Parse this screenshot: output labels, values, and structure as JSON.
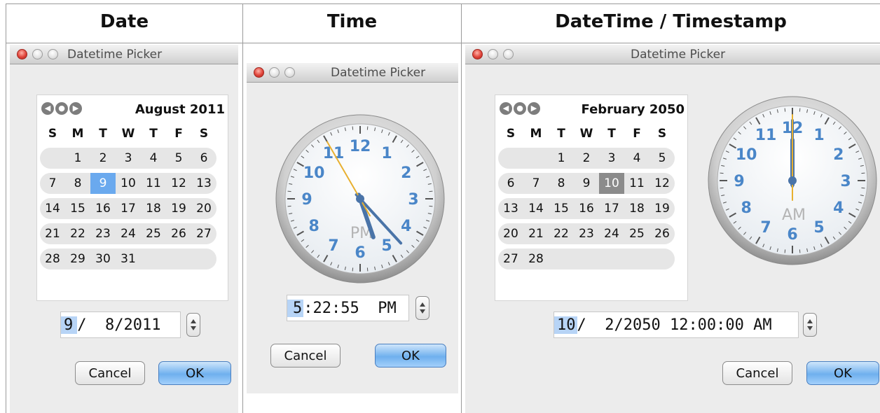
{
  "headers": {
    "date": "Date",
    "time": "Time",
    "datetime": "DateTime / Timestamp"
  },
  "windows": {
    "date": {
      "title": "Datetime Picker",
      "calendar": {
        "month_label": "August 2011",
        "nav": [
          "prev",
          "today",
          "next"
        ],
        "day_headers": [
          "S",
          "M",
          "T",
          "W",
          "T",
          "F",
          "S"
        ],
        "weeks": [
          [
            "",
            "1",
            "2",
            "3",
            "4",
            "5",
            "6"
          ],
          [
            "7",
            "8",
            "9",
            "10",
            "11",
            "12",
            "13"
          ],
          [
            "14",
            "15",
            "16",
            "17",
            "18",
            "19",
            "20"
          ],
          [
            "21",
            "22",
            "23",
            "24",
            "25",
            "26",
            "27"
          ],
          [
            "28",
            "29",
            "30",
            "31",
            "",
            "",
            ""
          ]
        ],
        "selected_day": "9"
      },
      "field": {
        "hl": "9",
        "rest": "/  8/2011"
      },
      "cancel_label": "Cancel",
      "ok_label": "OK"
    },
    "time": {
      "title": "Datetime Picker",
      "clock": {
        "hour": 5,
        "minute": 22,
        "second": 55,
        "period": "PM",
        "numerals": [
          "12",
          "1",
          "2",
          "3",
          "4",
          "5",
          "6",
          "7",
          "8",
          "9",
          "10",
          "11"
        ]
      },
      "field": {
        "hl": "5",
        "rest": ":22:55  PM"
      },
      "cancel_label": "Cancel",
      "ok_label": "OK"
    },
    "datetime": {
      "title": "Datetime Picker",
      "calendar": {
        "month_label": "February 2050",
        "nav": [
          "prev",
          "today",
          "next"
        ],
        "day_headers": [
          "S",
          "M",
          "T",
          "W",
          "T",
          "F",
          "S"
        ],
        "weeks": [
          [
            "",
            "",
            "1",
            "2",
            "3",
            "4",
            "5"
          ],
          [
            "6",
            "7",
            "8",
            "9",
            "10",
            "11",
            "12"
          ],
          [
            "13",
            "14",
            "15",
            "16",
            "17",
            "18",
            "19"
          ],
          [
            "20",
            "21",
            "22",
            "23",
            "24",
            "25",
            "26"
          ],
          [
            "27",
            "28",
            "",
            "",
            "",
            "",
            ""
          ]
        ],
        "selected_day": "10"
      },
      "clock": {
        "hour": 12,
        "minute": 0,
        "second": 0,
        "period": "AM",
        "numerals": [
          "12",
          "1",
          "2",
          "3",
          "4",
          "5",
          "6",
          "7",
          "8",
          "9",
          "10",
          "11"
        ]
      },
      "field": {
        "hl": "10",
        "rest": "/  2/2050 12:00:00 AM"
      },
      "cancel_label": "Cancel",
      "ok_label": "OK"
    }
  },
  "colors": {
    "numeral": "#4a86c8",
    "minute_hand": "#4a74a8",
    "second_hand": "#e8b030",
    "selected_blue": "#6aa9ee",
    "selected_gray": "#8b8b8b"
  }
}
